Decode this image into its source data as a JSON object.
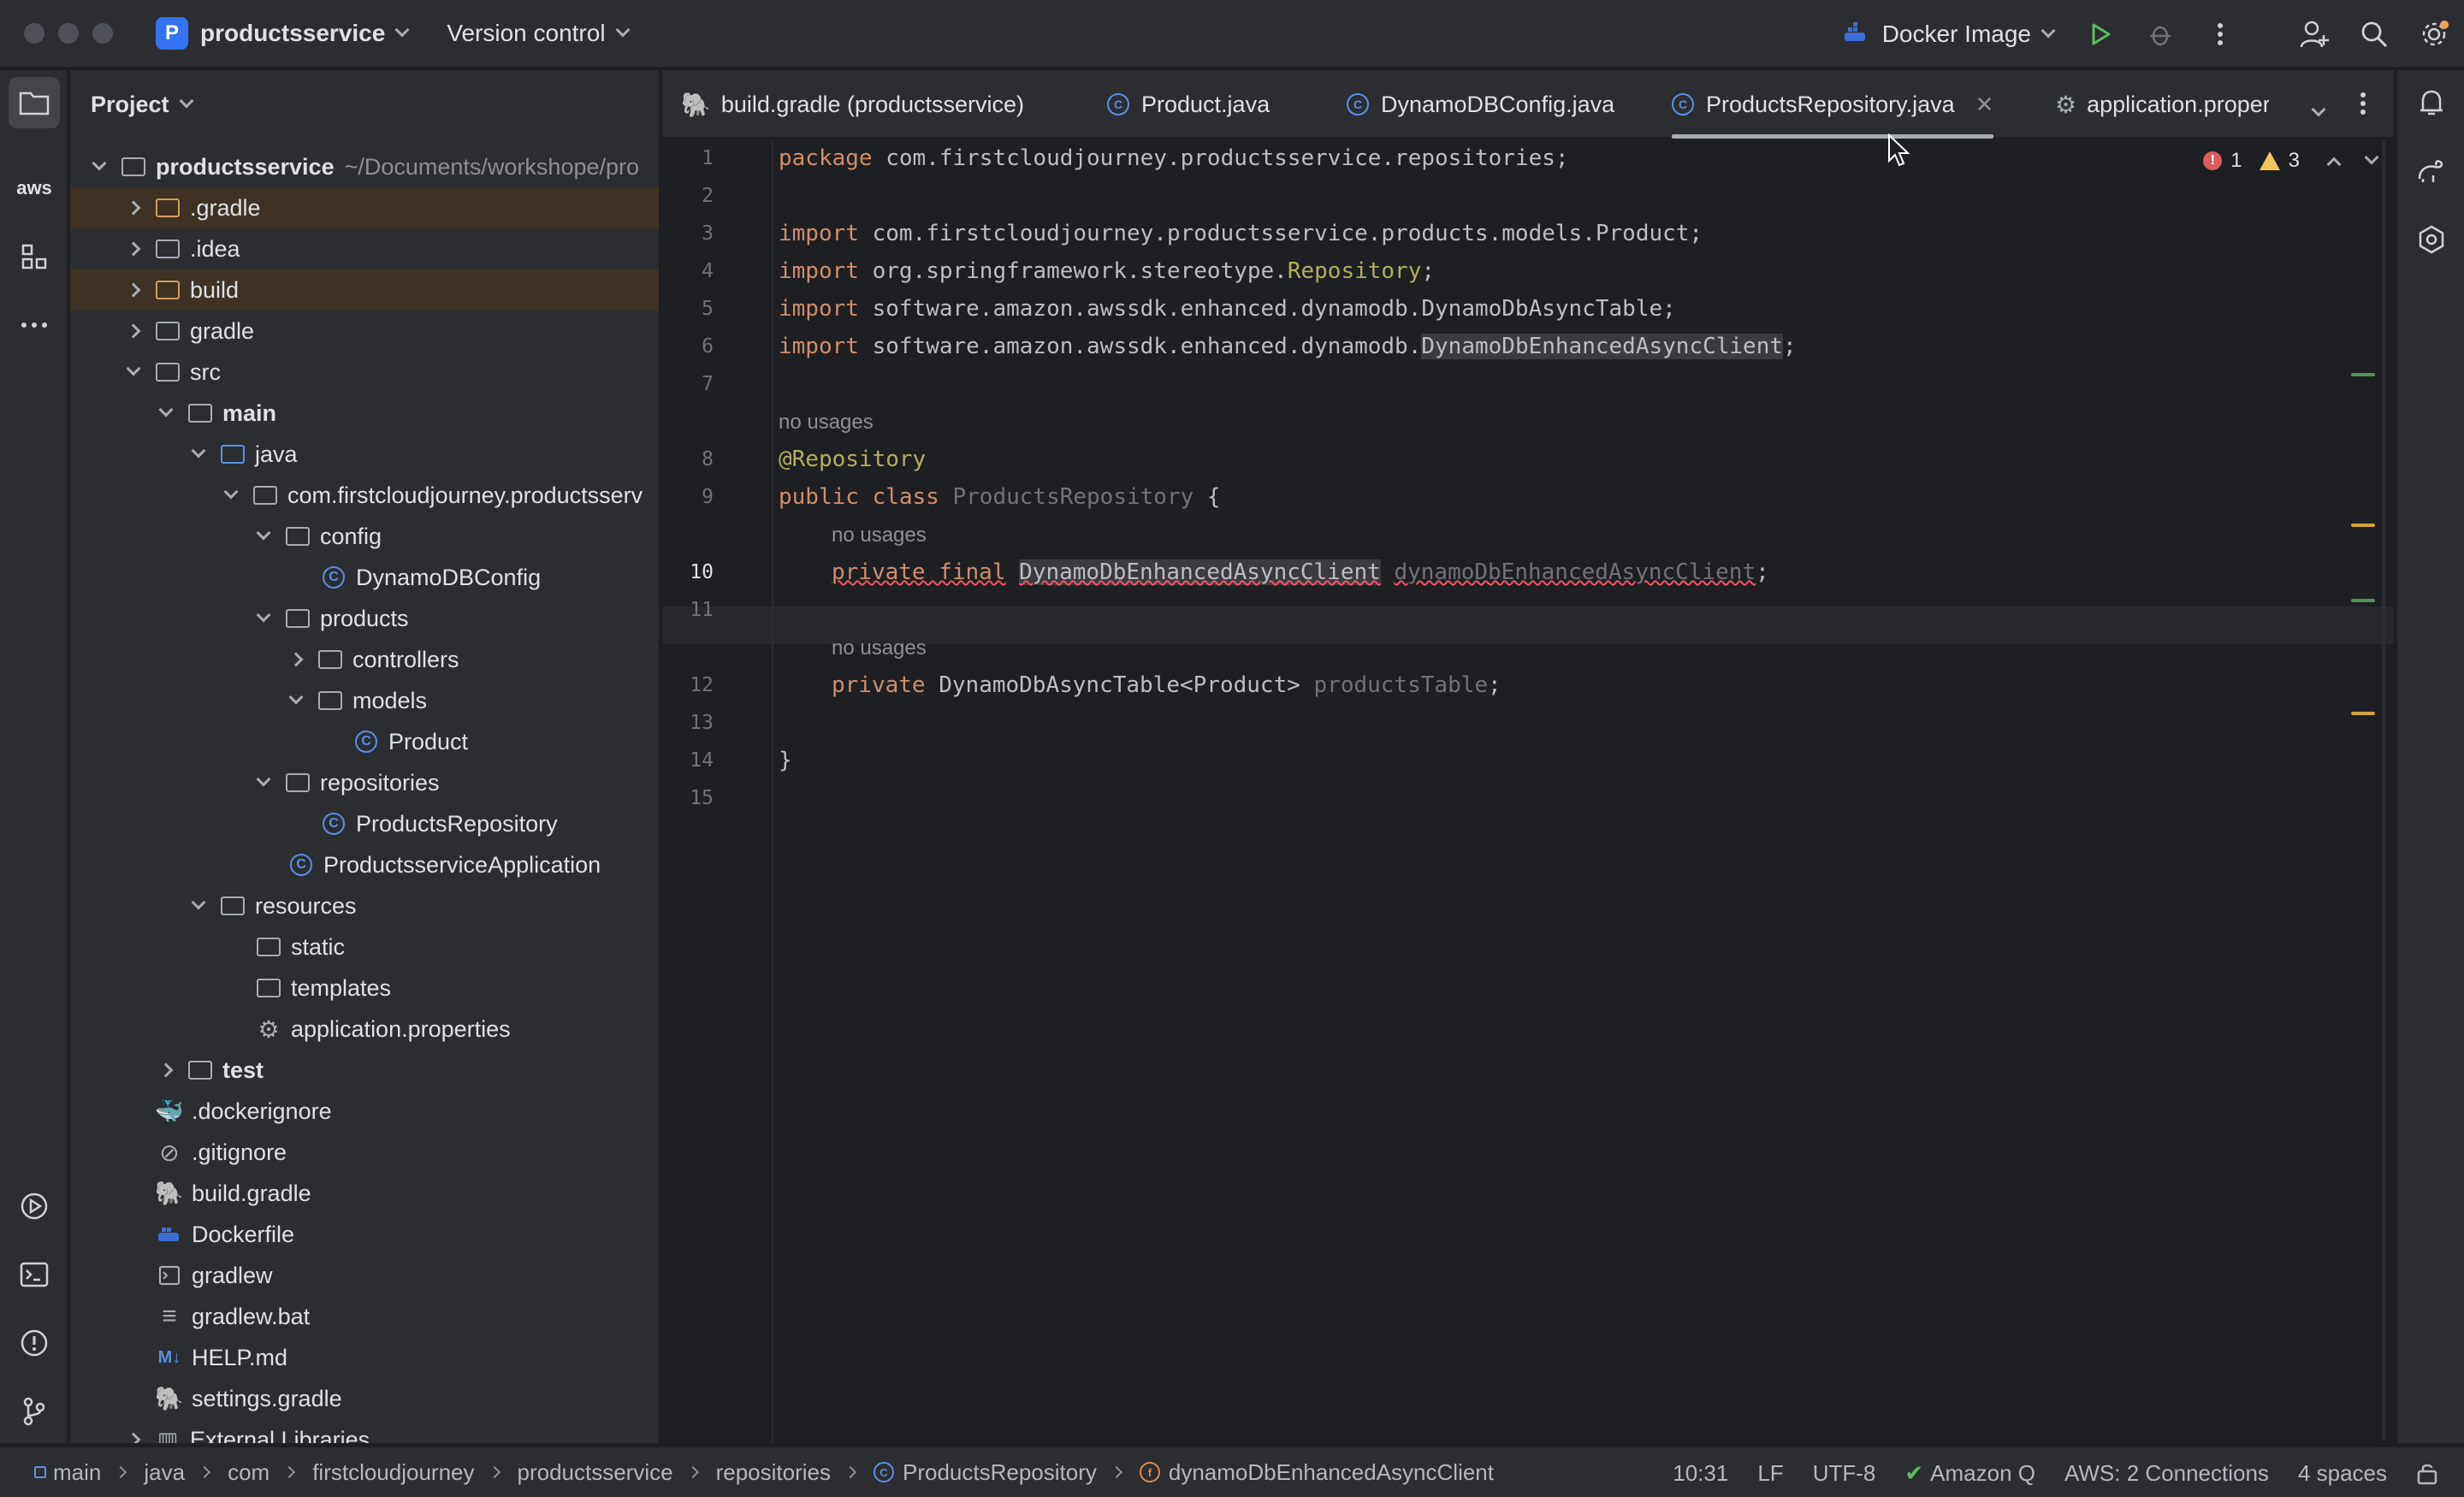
{
  "titlebar": {
    "project_badge": "P",
    "project_name": "productsservice",
    "vcs_label": "Version control",
    "run_config": "Docker Image"
  },
  "project_panel": {
    "title": "Project",
    "root_name": "productsservice",
    "root_path": "~/Documents/workshope/pro",
    "items": [
      {
        "label": ".gradle"
      },
      {
        "label": ".idea"
      },
      {
        "label": "build"
      },
      {
        "label": "gradle"
      },
      {
        "label": "src"
      },
      {
        "label": "main"
      },
      {
        "label": "java"
      },
      {
        "label": "com.firstcloudjourney.productsserv"
      },
      {
        "label": "config"
      },
      {
        "label": "DynamoDBConfig"
      },
      {
        "label": "products"
      },
      {
        "label": "controllers"
      },
      {
        "label": "models"
      },
      {
        "label": "Product"
      },
      {
        "label": "repositories"
      },
      {
        "label": "ProductsRepository"
      },
      {
        "label": "ProductsserviceApplication"
      },
      {
        "label": "resources"
      },
      {
        "label": "static"
      },
      {
        "label": "templates"
      },
      {
        "label": "application.properties"
      },
      {
        "label": "test"
      },
      {
        "label": ".dockerignore"
      },
      {
        "label": ".gitignore"
      },
      {
        "label": "build.gradle"
      },
      {
        "label": "Dockerfile"
      },
      {
        "label": "gradlew"
      },
      {
        "label": "gradlew.bat"
      },
      {
        "label": "HELP.md"
      },
      {
        "label": "settings.gradle"
      },
      {
        "label": "External Libraries"
      }
    ]
  },
  "tabs": [
    {
      "label": "build.gradle (productsservice)"
    },
    {
      "label": "Product.java"
    },
    {
      "label": "DynamoDBConfig.java"
    },
    {
      "label": "ProductsRepository.java"
    },
    {
      "label": "application.proper"
    }
  ],
  "inspections": {
    "errors": "1",
    "warnings": "3"
  },
  "code": {
    "line_numbers": [
      "1",
      "2",
      "3",
      "4",
      "5",
      "6",
      "7",
      "8",
      "9",
      "10",
      "11",
      "12",
      "13",
      "14",
      "15"
    ],
    "l1_kw": "package",
    "l1_rest": " com.firstcloudjourney.productsservice.repositories;",
    "l3_kw": "import",
    "l3_rest": " com.firstcloudjourney.productsservice.products.models.Product;",
    "l4_kw": "import",
    "l4_a": " org.springframework.stereotype.",
    "l4_ann": "Repository",
    "l4_end": ";",
    "l5_kw": "import",
    "l5_rest": " software.amazon.awssdk.enhanced.dynamodb.DynamoDbAsyncTable;",
    "l6_kw": "import",
    "l6_a": " software.amazon.awssdk.enhanced.dynamodb.",
    "l6_hl": "DynamoDbEnhancedAsyncClient",
    "l6_end": ";",
    "hint1": "no usages",
    "l8_ann": "@Repository",
    "l9_kw": "public class",
    "l9_name": " ProductsRepository",
    "l9_end": " {",
    "hint2": "no usages",
    "l10_kw": "private final",
    "l10_type": "DynamoDbEnhancedAsyncClient",
    "l10_field": "dynamoDbEnhancedAsyncClient",
    "l10_end": ";",
    "hint3": "no usages",
    "l12_kw": "private",
    "l12_type": " DynamoDbAsyncTable<Product> ",
    "l12_field": "productsTable",
    "l12_end": ";",
    "l14": "}"
  },
  "statusbar": {
    "breadcrumbs": [
      "main",
      "java",
      "com",
      "firstcloudjourney",
      "productsservice",
      "repositories",
      "ProductsRepository",
      "dynamoDbEnhancedAsyncClient"
    ],
    "position": "10:31",
    "line_sep": "LF",
    "encoding": "UTF-8",
    "amazon_q": "Amazon Q",
    "aws": "AWS: 2 Connections",
    "indent": "4 spaces"
  },
  "icons": {
    "aws_label": "aws"
  },
  "colors": {
    "accent": "#3574f0",
    "keyword": "#cf8e6d",
    "annotation": "#b3ae60",
    "error": "#db5c5c",
    "warning": "#f2c55c"
  }
}
